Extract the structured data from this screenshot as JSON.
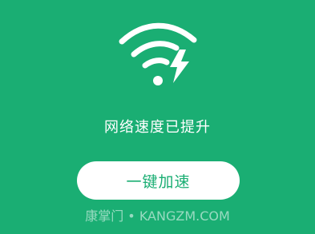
{
  "colors": {
    "background": "#1aae73",
    "button_background": "#ffffff",
    "button_text": "#1aae73",
    "text": "#ffffff"
  },
  "icon": {
    "name": "wifi-lightning-icon"
  },
  "status": {
    "text": "网络速度已提升"
  },
  "actions": {
    "boost_label": "一键加速"
  },
  "watermark": {
    "text": "康掌门 • KANGZM.COM"
  }
}
